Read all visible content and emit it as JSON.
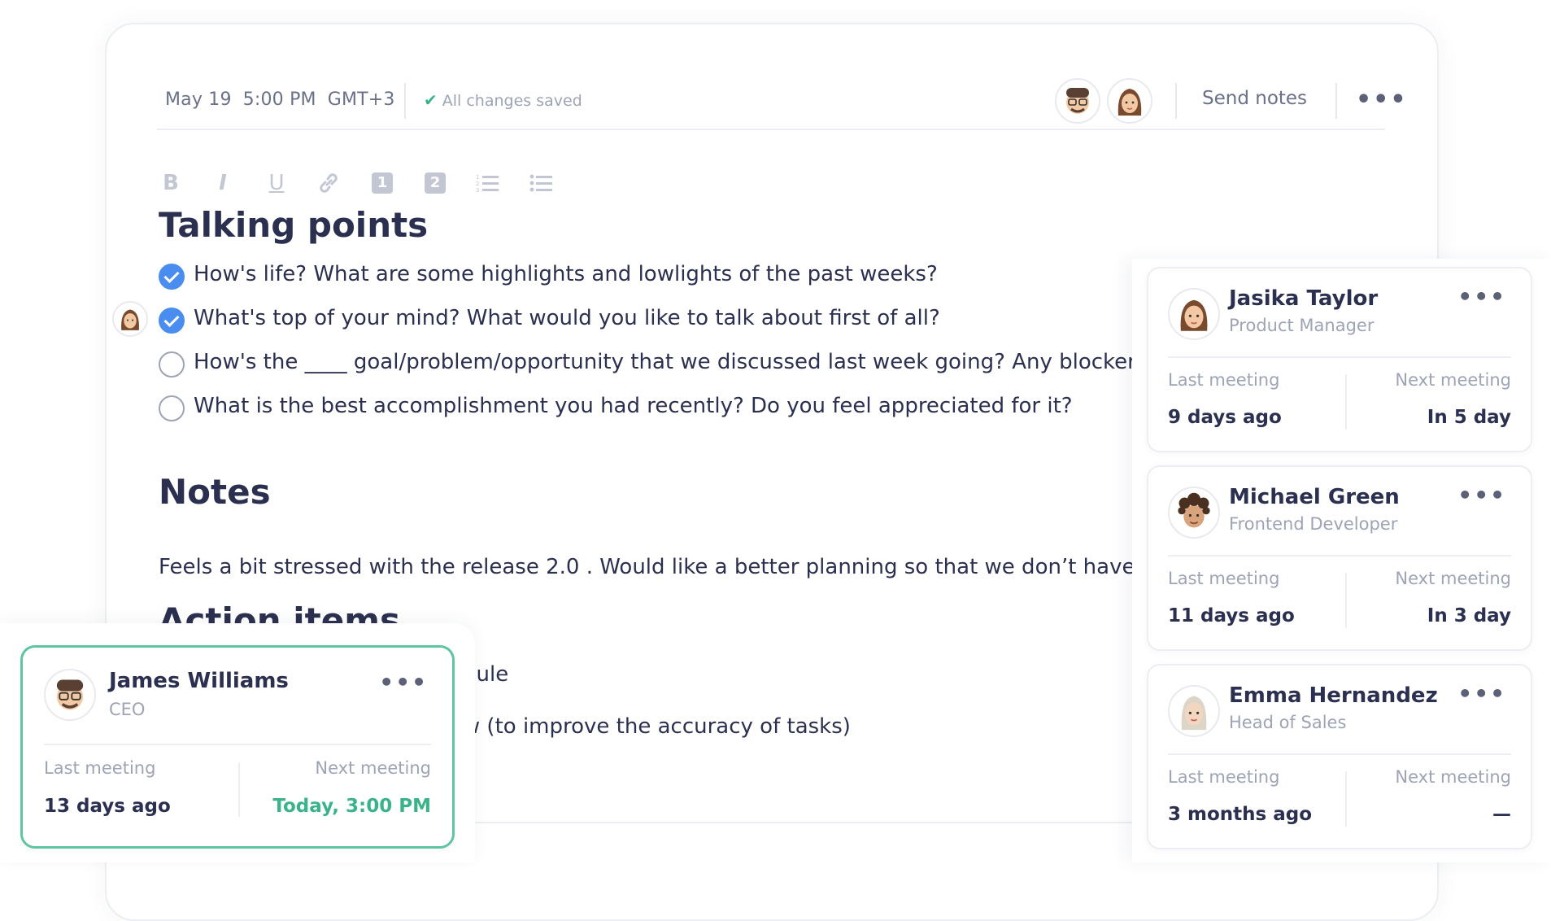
{
  "header": {
    "date": "May 19",
    "time": "5:00 PM",
    "timezone": "GMT+3",
    "saved_status": "All changes saved",
    "send_label": "Send notes",
    "more_label": "•••"
  },
  "toolbar": {
    "bold": "B",
    "italic": "I",
    "underline": "U",
    "link_icon": "link-icon",
    "h1": "1",
    "h2": "2",
    "ordered_list_icon": "ordered-list-icon",
    "bullet_list_icon": "bullet-list-icon"
  },
  "talking_points": {
    "title": "Talking points",
    "items": [
      {
        "text": "How's life? What are some highlights and lowlights of the past weeks?",
        "done": true
      },
      {
        "text": "What's top of your mind? What would you like to talk about first of all?",
        "done": true
      },
      {
        "text": "How's the ____ goal/problem/opportunity that we discussed last week going? Any blockers",
        "done": false
      },
      {
        "text": "What is the best accomplishment you had recently? Do you feel appreciated for it?",
        "done": false
      }
    ]
  },
  "notes": {
    "title": "Notes",
    "text": "Feels a bit stressed with the release 2.0 . Would like a better planning so that we don’t have to r"
  },
  "action_items": {
    "title": "Action items",
    "items": [
      "edule",
      "ow (to improve the accuracy of tasks)"
    ]
  },
  "people": [
    {
      "name": "Jasika Taylor",
      "role": "Product Manager",
      "last_label": "Last meeting",
      "next_label": "Next meeting",
      "last": "9 days ago",
      "next": "In 5 day"
    },
    {
      "name": "Michael Green",
      "role": "Frontend Developer",
      "last_label": "Last meeting",
      "next_label": "Next meeting",
      "last": "11 days ago",
      "next": "In 3 day"
    },
    {
      "name": "Emma Hernandez",
      "role": "Head of Sales",
      "last_label": "Last meeting",
      "next_label": "Next meeting",
      "last": "3 months ago",
      "next": "—"
    }
  ],
  "featured": {
    "name": "James Williams",
    "role": "CEO",
    "last_label": "Last meeting",
    "next_label": "Next meeting",
    "last": "13 days ago",
    "next": "Today, 3:00 PM"
  },
  "colors": {
    "accent_blue": "#4a8df0",
    "accent_green": "#3bb38a",
    "text_dark": "#2c3050",
    "text_muted": "#9ea3b5"
  }
}
